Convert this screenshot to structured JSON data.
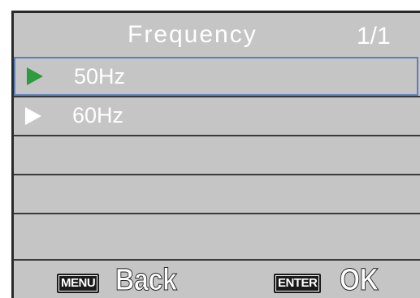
{
  "header": {
    "title": "Frequency",
    "page_indicator": "1/1"
  },
  "options": [
    {
      "label": "50Hz",
      "selected": true,
      "icon": "green-play-arrow-icon"
    },
    {
      "label": "60Hz",
      "selected": false,
      "icon": "white-play-arrow-icon"
    }
  ],
  "empty_rows": 3,
  "footer": {
    "menu_key": "MENU",
    "back_label": "Back",
    "enter_key": "ENTER",
    "ok_label": "OK"
  },
  "colors": {
    "background": "#c5c5c5",
    "selection_border": "#5b7fbd",
    "selected_arrow": "#2e9b3f",
    "text": "#ffffff"
  }
}
